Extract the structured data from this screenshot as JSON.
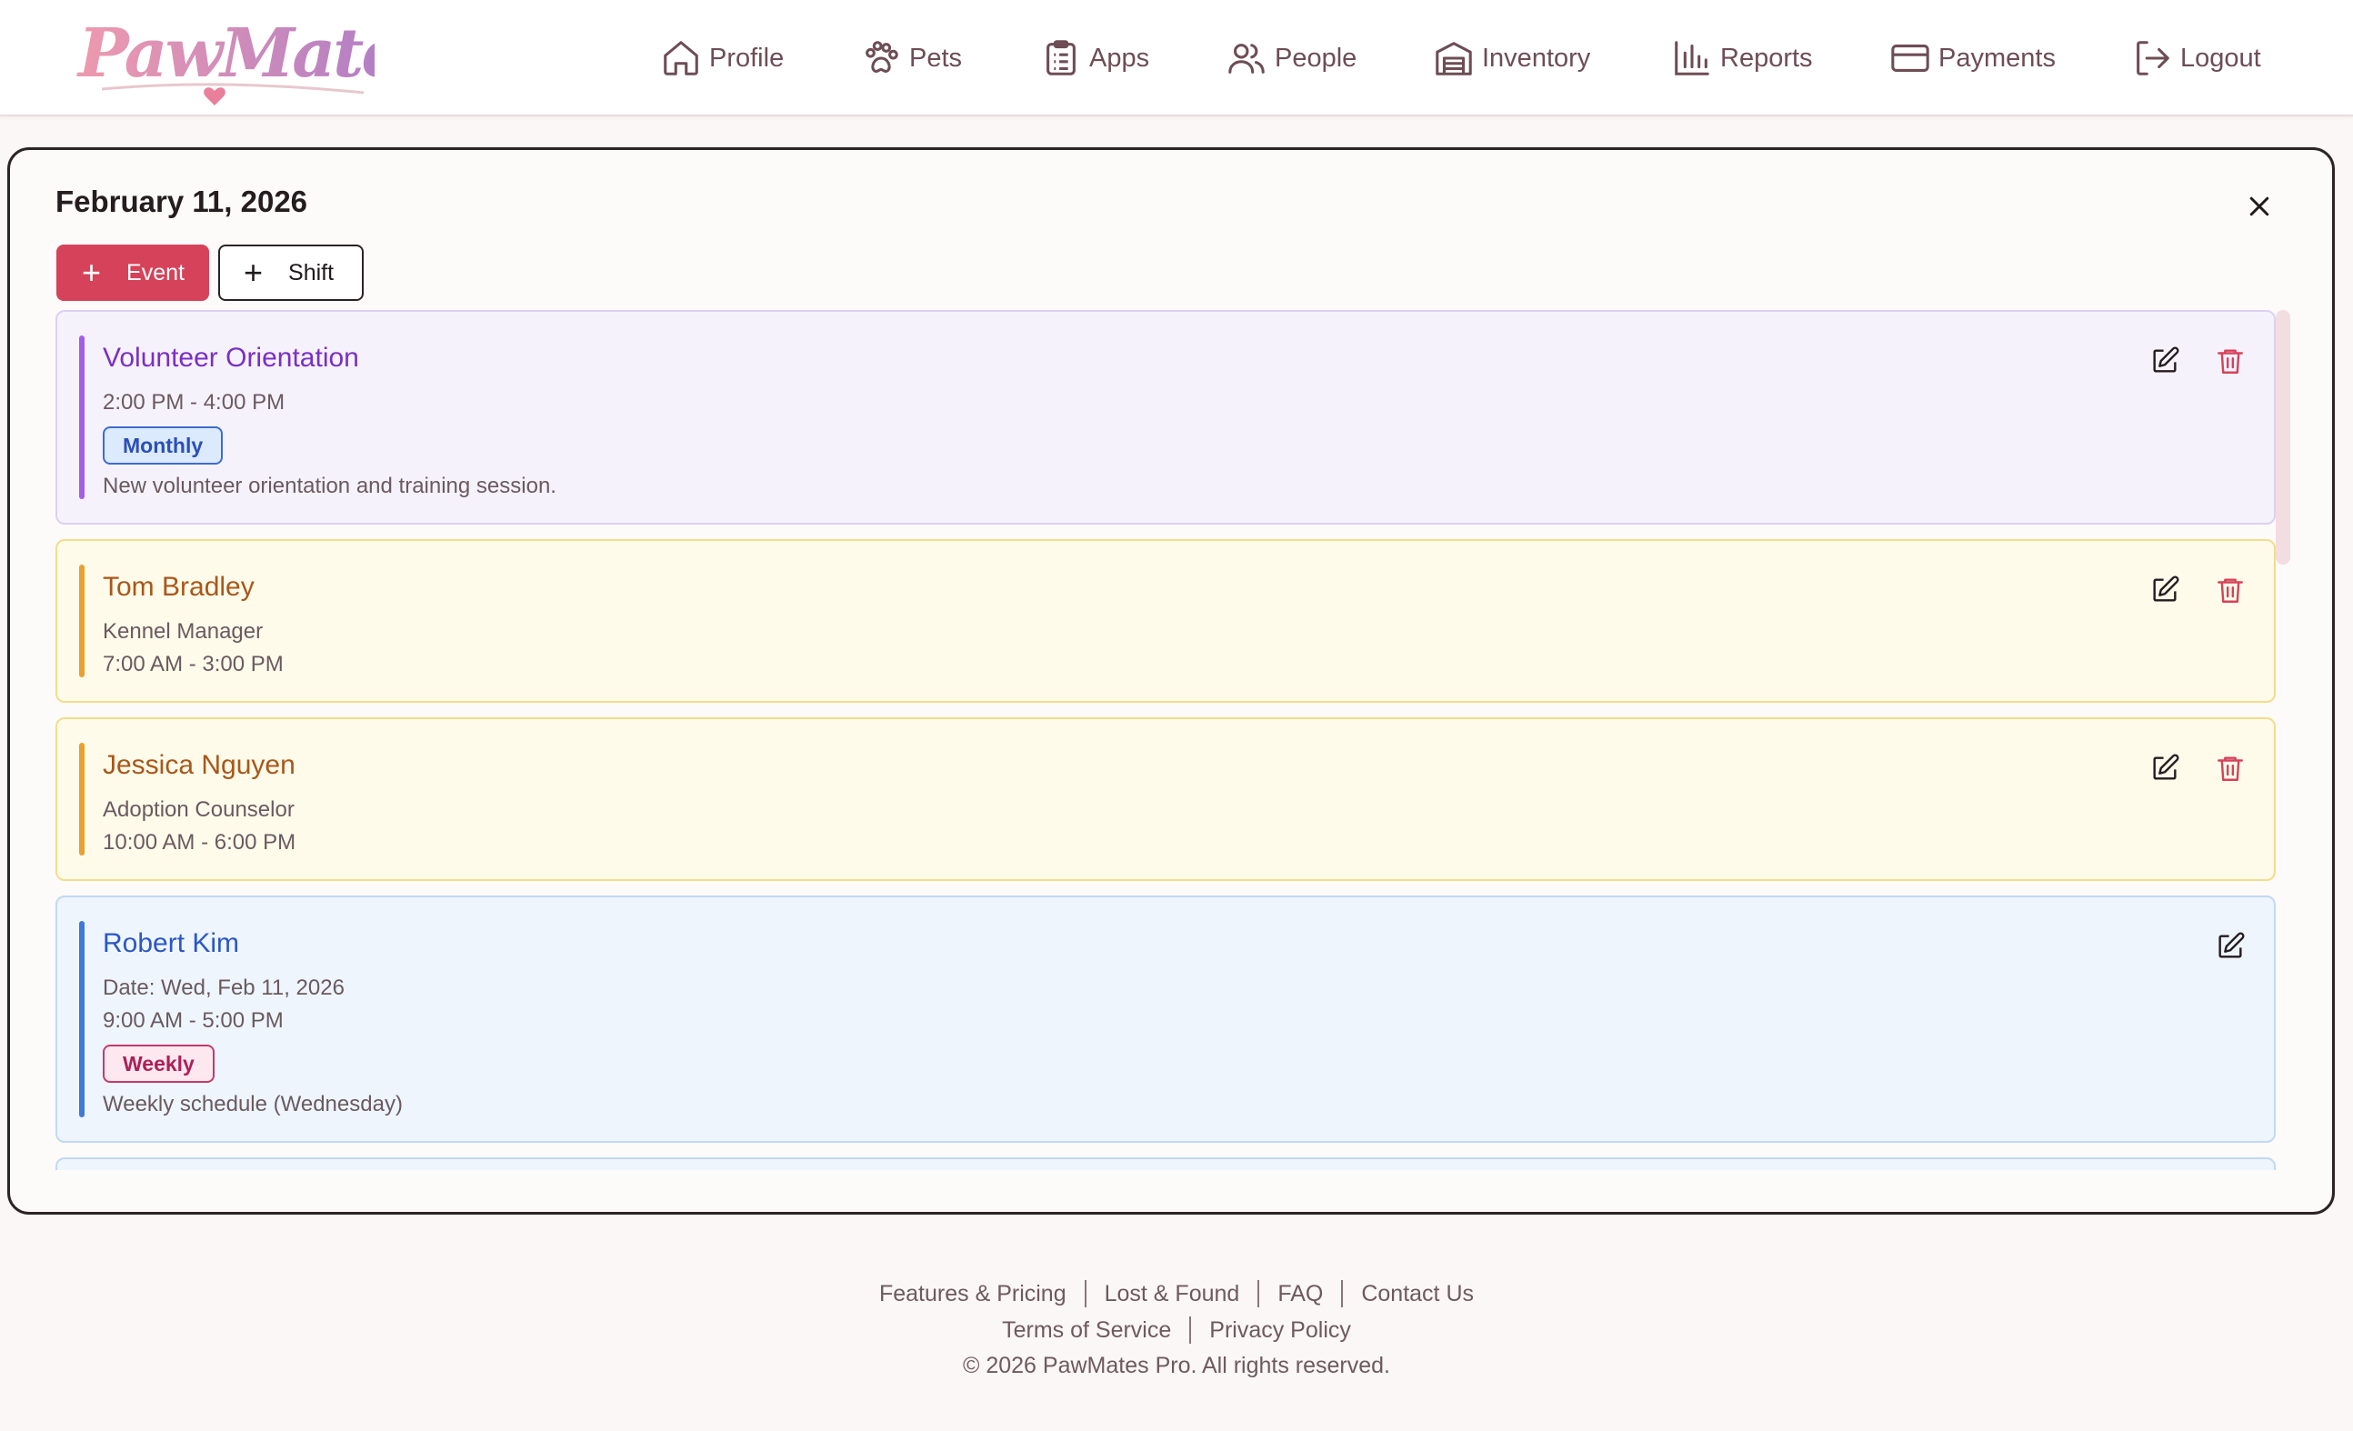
{
  "brand": {
    "logo_text": "PawMates"
  },
  "nav": [
    {
      "label": "Profile",
      "icon": "home-icon"
    },
    {
      "label": "Pets",
      "icon": "paw-icon"
    },
    {
      "label": "Apps",
      "icon": "clipboard-icon"
    },
    {
      "label": "People",
      "icon": "people-icon"
    },
    {
      "label": "Inventory",
      "icon": "warehouse-icon"
    },
    {
      "label": "Reports",
      "icon": "bar-chart-icon"
    },
    {
      "label": "Payments",
      "icon": "credit-card-icon"
    },
    {
      "label": "Logout",
      "icon": "logout-icon"
    }
  ],
  "modal": {
    "date_title": "February 11, 2026",
    "add_event_label": "Event",
    "add_shift_label": "Shift"
  },
  "entries": [
    {
      "title": "Volunteer Orientation",
      "time": "2:00 PM - 4:00 PM",
      "badge": "Monthly",
      "description": "New volunteer orientation and training session."
    },
    {
      "title": "Tom Bradley",
      "role": "Kennel Manager",
      "time": "7:00 AM - 3:00 PM"
    },
    {
      "title": "Jessica Nguyen",
      "role": "Adoption Counselor",
      "time": "10:00 AM - 6:00 PM"
    },
    {
      "title": "Robert Kim",
      "date": "Date: Wed, Feb 11, 2026",
      "time": "9:00 AM - 5:00 PM",
      "badge": "Weekly",
      "description": "Weekly schedule (Wednesday)"
    }
  ],
  "footer": {
    "links_row1": [
      "Features & Pricing",
      "Lost & Found",
      "FAQ",
      "Contact Us"
    ],
    "links_row2": [
      "Terms of Service",
      "Privacy Policy"
    ],
    "copyright": "© 2026 PawMates Pro. All rights reserved."
  },
  "colors": {
    "accent": "#d6425a",
    "event_purple": "#a45ee6",
    "shift_yellow": "#e8a030",
    "schedule_blue": "#3f79d8",
    "delete_red": "#d6425a"
  }
}
